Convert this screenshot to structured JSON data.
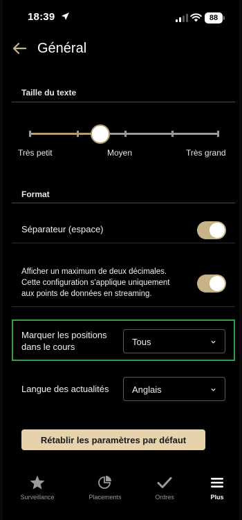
{
  "status_bar": {
    "time": "18:39",
    "battery": "88"
  },
  "header": {
    "title": "Général"
  },
  "text_size": {
    "section_label": "Taille du texte",
    "slider": {
      "steps": 5,
      "selected_index": 1
    },
    "labels": {
      "small": "Très petit",
      "medium": "Moyen",
      "large": "Très grand"
    }
  },
  "format": {
    "section_label": "Format",
    "separator": {
      "label": "Séparateur (espace)",
      "enabled": true
    },
    "decimals": {
      "lines": [
        "Afficher un maximum de deux décimales.",
        "Cette configuration s'applique uniquement",
        "aux points de données en streaming."
      ],
      "enabled": true
    },
    "mark_positions": {
      "lines": [
        "Marquer les positions",
        "dans le cours"
      ],
      "value": "Tous"
    },
    "news_language": {
      "label": "Langue des actualités",
      "value": "Anglais"
    }
  },
  "reset_button": "Rétablir les paramètres par défaut",
  "tabs": [
    {
      "label": "Surveillance",
      "icon": "star-icon",
      "active": false
    },
    {
      "label": "Placements",
      "icon": "pie-chart-icon",
      "active": false
    },
    {
      "label": "Ordres",
      "icon": "checkmark-icon",
      "active": false
    },
    {
      "label": "Plus",
      "icon": "menu-icon",
      "active": true
    }
  ],
  "colors": {
    "accent": "#c7b387",
    "button": "#e6d3ac",
    "highlight_border": "#2fa043",
    "background": "#000000"
  }
}
